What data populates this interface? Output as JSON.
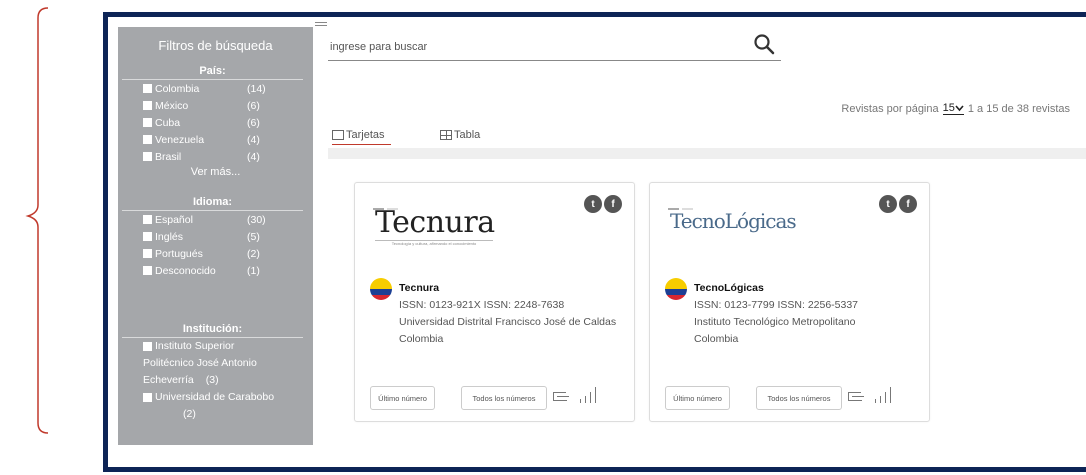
{
  "sidebar": {
    "title": "Filtros de búsqueda",
    "pais": {
      "title": "País:",
      "items": [
        {
          "label": "Colombia",
          "count": "(14)"
        },
        {
          "label": "México",
          "count": "(6)"
        },
        {
          "label": "Cuba",
          "count": "(6)"
        },
        {
          "label": "Venezuela",
          "count": "(4)"
        },
        {
          "label": "Brasil",
          "count": "(4)"
        }
      ],
      "more": "Ver más..."
    },
    "idioma": {
      "title": "Idioma:",
      "items": [
        {
          "label": "Español",
          "count": "(30)"
        },
        {
          "label": "Inglés",
          "count": "(5)"
        },
        {
          "label": "Portugués",
          "count": "(2)"
        },
        {
          "label": "Desconocido",
          "count": "(1)"
        }
      ]
    },
    "institucion": {
      "title": "Institución:",
      "items": [
        {
          "label": "Instituto Superior Politécnico José Antonio Echeverría",
          "count": "(3)"
        },
        {
          "label": "Universidad de Carabobo",
          "count": "(2)"
        }
      ]
    }
  },
  "search": {
    "placeholder": "ingrese para buscar",
    "value": ""
  },
  "paging": {
    "label": "Revistas por página",
    "per_page": "15",
    "range": "1 a 15 de 38 revistas"
  },
  "tabs": [
    {
      "label": "Tarjetas",
      "active": true
    },
    {
      "label": "Tabla",
      "active": false
    }
  ],
  "cards": [
    {
      "logo_text": "Tecnura",
      "logo_subtitle": "Tecnología y cultura, afirmando el conocimiento",
      "name": "Tecnura",
      "issn": "ISSN: 0123-921X ISSN: 2248-7638",
      "institution": "Universidad Distrital Francisco José de Caldas",
      "country": "Colombia",
      "btn_last": "Último número",
      "btn_all": "Todos los números"
    },
    {
      "logo_text": "TecnoLógicas",
      "name": "TecnoLógicas",
      "issn": "ISSN: 0123-7799 ISSN: 2256-5337",
      "institution": "Instituto Tecnológico Metropolitano",
      "country": "Colombia",
      "btn_last": "Último número",
      "btn_all": "Todos los números"
    }
  ],
  "social_icons": [
    "twitter-icon",
    "facebook-icon"
  ],
  "colors": {
    "frame": "#0d2456",
    "sidebar": "#a5a7aa",
    "brace": "#c0392b",
    "active_tab": "#c0392b"
  }
}
